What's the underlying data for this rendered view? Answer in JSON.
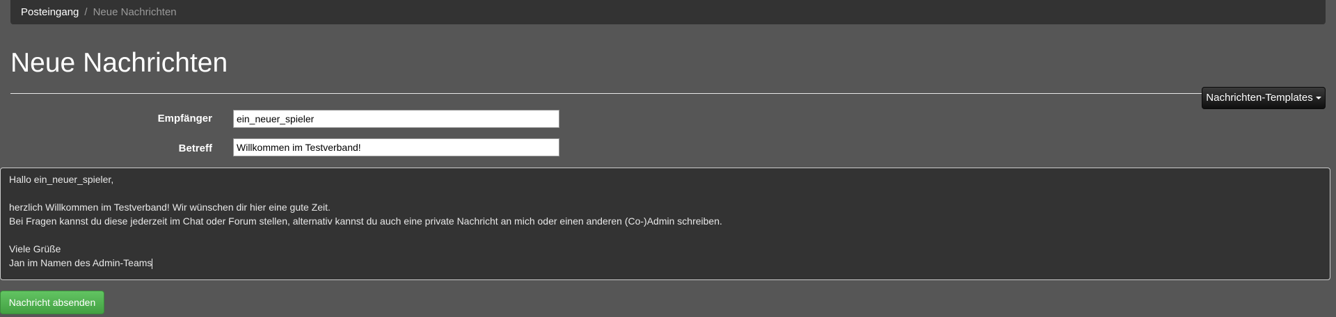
{
  "breadcrumb": {
    "inbox_label": "Posteingang",
    "separator": "/",
    "current_label": "Neue Nachrichten"
  },
  "page": {
    "title": "Neue Nachrichten"
  },
  "templates_button": {
    "label": "Nachrichten-Templates",
    "icon": "caret-down-icon"
  },
  "form": {
    "recipient": {
      "label": "Empfänger",
      "value": "ein_neuer_spieler"
    },
    "subject": {
      "label": "Betreff",
      "value": "Willkommen im Testverband!"
    },
    "message_lines": [
      "Hallo ein_neuer_spieler,",
      "",
      "herzlich Willkommen im Testverband! Wir wünschen dir hier eine gute Zeit.",
      "Bei Fragen kannst du diese jederzeit im Chat oder Forum stellen, alternativ kannst du auch eine private Nachricht an mich oder einen anderen (Co-)Admin schreiben.",
      "",
      "Viele Grüße",
      "Jan im Namen des Admin-Teams"
    ]
  },
  "send_button": {
    "label": "Nachricht absenden"
  },
  "colors": {
    "background": "#565656",
    "panel": "#333333",
    "send_button": "#5cb85c",
    "templates_button": "#1a1a1a"
  }
}
